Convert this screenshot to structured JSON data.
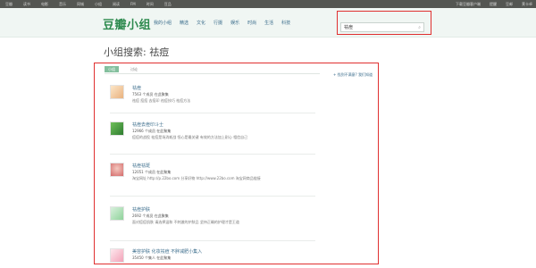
{
  "topbar": {
    "links": [
      "豆瓣",
      "读书",
      "电影",
      "音乐",
      "同城",
      "小组",
      "阅读",
      "FM",
      "时间",
      "豆品"
    ],
    "right": [
      "下载豆瓣客户端",
      "提醒",
      "豆邮",
      "莱卡卓"
    ]
  },
  "header": {
    "logo": "豆瓣小组",
    "nav": [
      "我的小组",
      "精选",
      "文化",
      "行摄",
      "娱乐",
      "时尚",
      "生活",
      "科技"
    ],
    "search": {
      "value": "祛痘",
      "placeholder": ""
    },
    "search_icon": "search-icon"
  },
  "page_title": "小组搜索: 祛痘",
  "tabs": {
    "active": "小组",
    "other": "讨论"
  },
  "results": [
    {
      "name": "祛痘",
      "meta": "7563 个成员 在此聚集",
      "desc": "祛痘 痘痘 去痘印 祛痘技巧 祛痘方法",
      "thumb": "a"
    },
    {
      "name": "祛痘去痘印斗士",
      "meta": "12966 个成员 在此聚集",
      "desc": "痘痘的战役 祛痘是场消耗战 恒心是最关键 有效的方法加上耐心 相信自己",
      "thumb": "b"
    },
    {
      "name": "祛痘祛斑",
      "meta": "12051 个成员 在此聚集",
      "desc": "淘宝网址 http://p.22bo.com 分享好物 http://www.22bo.com 淘宝网商品链接",
      "thumb": "c"
    },
    {
      "name": "祛痘护肤",
      "meta": "2692 个成员 在此聚集",
      "desc": "面对痘痘肌肤 请选择温和 不刺激的护肤品 坚持正确的护理才是王道",
      "thumb": "d"
    },
    {
      "name": "美容护肤 化妆祛痘 不胖减肥小集入",
      "meta": "35450 个集人 在此聚集",
      "desc": "",
      "thumb": "e"
    }
  ],
  "side_link": "+ 找到不满意? 我们知道"
}
